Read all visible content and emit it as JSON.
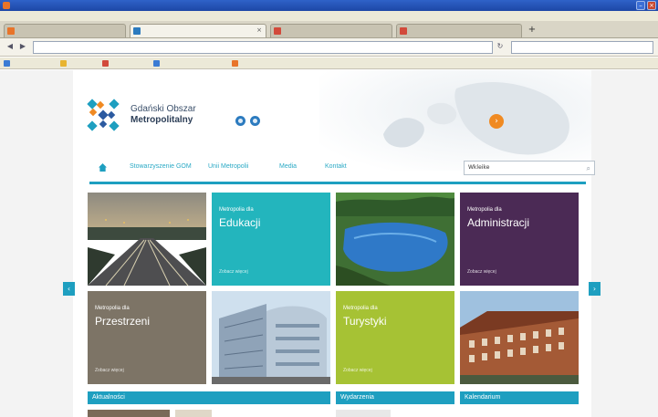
{
  "browser": {
    "title": "",
    "menu": [],
    "tabs": [
      {
        "label": "",
        "active": false,
        "icon_color": "#e8742a"
      },
      {
        "label": "",
        "active": true,
        "icon_color": "#2c7bbf"
      },
      {
        "label": "",
        "active": false,
        "icon_color": "#d24a3b"
      },
      {
        "label": "",
        "active": false,
        "icon_color": "#d24a3b"
      }
    ],
    "url": "",
    "search_text": "",
    "bookmarks": [
      {
        "label": "",
        "icon_color": "#3b7bd4"
      },
      {
        "label": "",
        "icon_color": "#e8b430"
      },
      {
        "label": "",
        "icon_color": "#d24a3b"
      },
      {
        "label": "",
        "icon_color": "#3b7bd4"
      },
      {
        "label": "",
        "icon_color": "#e8742a"
      }
    ]
  },
  "site": {
    "logo": {
      "line1": "Gdański Obszar",
      "line2": "Metropolitalny"
    },
    "social_icons": [
      "facebook-icon",
      "share-icon"
    ],
    "nav": {
      "items": [
        "Stowarzyszenie GOM",
        "Unii Metropolii",
        "Media",
        "Kontakt"
      ],
      "search_value": "Wkleike"
    },
    "tiles": [
      {
        "kind": "photo",
        "scene": "highway"
      },
      {
        "kind": "text",
        "kicker": "Metropolia dla",
        "title": "Edukacji",
        "more": "Zobacz więcej",
        "color": "#23b5bd"
      },
      {
        "kind": "photo",
        "scene": "lake"
      },
      {
        "kind": "text",
        "kicker": "Metropolia dla",
        "title": "Administracji",
        "more": "Zobacz więcej",
        "color": "#4b2a55"
      },
      {
        "kind": "text",
        "kicker": "Metropolia dla",
        "title": "Przestrzeni",
        "more": "Zobacz więcej",
        "color": "#7d7466"
      },
      {
        "kind": "photo",
        "scene": "building"
      },
      {
        "kind": "text",
        "kicker": "Metropolia dla",
        "title": "Turystyki",
        "more": "Zobacz więcej",
        "color": "#a6c234"
      },
      {
        "kind": "photo",
        "scene": "brick"
      }
    ],
    "sections": [
      "Aktualności",
      "Wydarzenia",
      "Kalendarium"
    ],
    "colors": {
      "accent": "#1e9fc0",
      "orange": "#f08a22"
    }
  }
}
